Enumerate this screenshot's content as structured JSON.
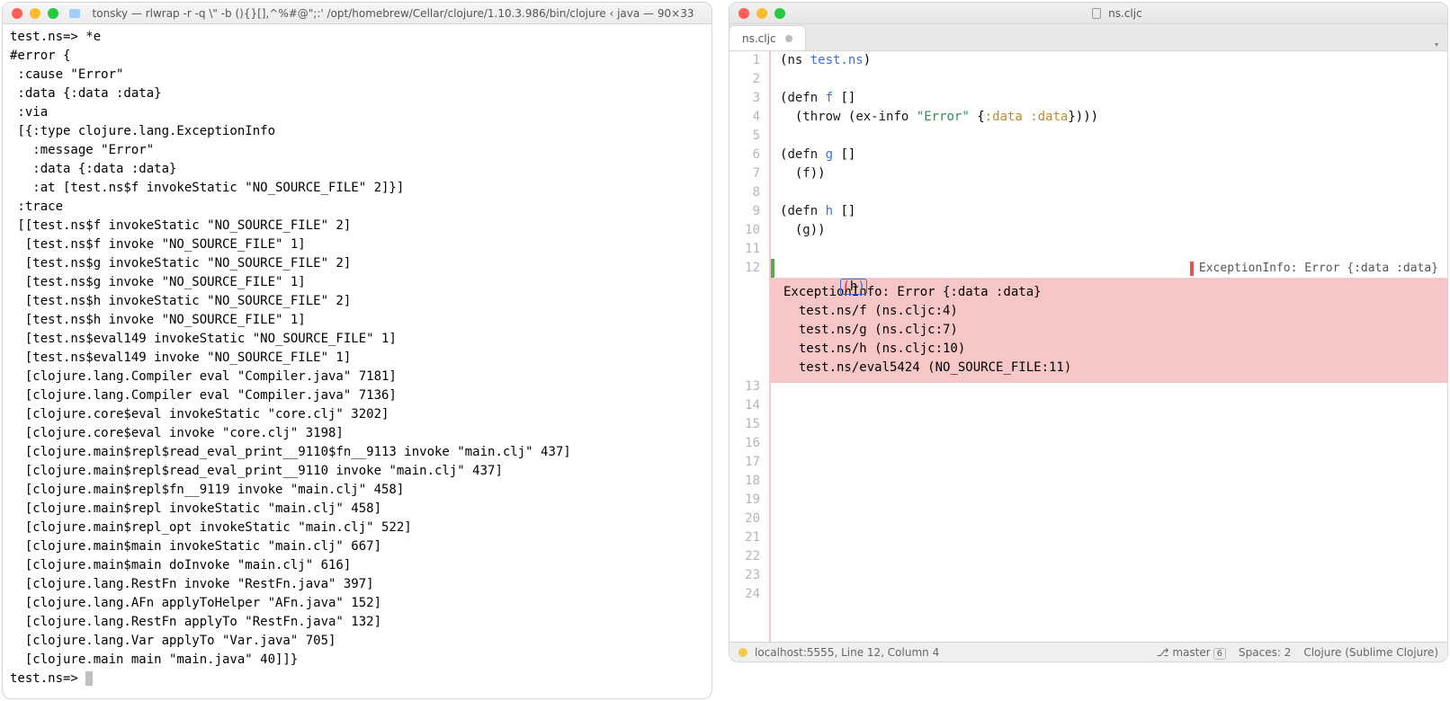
{
  "terminal": {
    "title": "tonsky — rlwrap -r -q \\\" -b (){}[],^%#@\";:' /opt/homebrew/Cellar/clojure/1.10.3.986/bin/clojure ‹ java — 90×33",
    "content": "test.ns=> *e\n#error {\n :cause \"Error\"\n :data {:data :data}\n :via\n [{:type clojure.lang.ExceptionInfo\n   :message \"Error\"\n   :data {:data :data}\n   :at [test.ns$f invokeStatic \"NO_SOURCE_FILE\" 2]}]\n :trace\n [[test.ns$f invokeStatic \"NO_SOURCE_FILE\" 2]\n  [test.ns$f invoke \"NO_SOURCE_FILE\" 1]\n  [test.ns$g invokeStatic \"NO_SOURCE_FILE\" 2]\n  [test.ns$g invoke \"NO_SOURCE_FILE\" 1]\n  [test.ns$h invokeStatic \"NO_SOURCE_FILE\" 2]\n  [test.ns$h invoke \"NO_SOURCE_FILE\" 1]\n  [test.ns$eval149 invokeStatic \"NO_SOURCE_FILE\" 1]\n  [test.ns$eval149 invoke \"NO_SOURCE_FILE\" 1]\n  [clojure.lang.Compiler eval \"Compiler.java\" 7181]\n  [clojure.lang.Compiler eval \"Compiler.java\" 7136]\n  [clojure.core$eval invokeStatic \"core.clj\" 3202]\n  [clojure.core$eval invoke \"core.clj\" 3198]\n  [clojure.main$repl$read_eval_print__9110$fn__9113 invoke \"main.clj\" 437]\n  [clojure.main$repl$read_eval_print__9110 invoke \"main.clj\" 437]\n  [clojure.main$repl$fn__9119 invoke \"main.clj\" 458]\n  [clojure.main$repl invokeStatic \"main.clj\" 458]\n  [clojure.main$repl_opt invokeStatic \"main.clj\" 522]\n  [clojure.main$main invokeStatic \"main.clj\" 667]\n  [clojure.main$main doInvoke \"main.clj\" 616]\n  [clojure.lang.RestFn invoke \"RestFn.java\" 397]\n  [clojure.lang.AFn applyToHelper \"AFn.java\" 152]\n  [clojure.lang.RestFn applyTo \"RestFn.java\" 132]\n  [clojure.lang.Var applyTo \"Var.java\" 705]\n  [clojure.main main \"main.java\" 40]]}",
    "prompt": "test.ns=> "
  },
  "editor": {
    "title": "ns.cljc",
    "tab": {
      "name": "ns.cljc"
    },
    "inline_error": "ExceptionInfo: Error {:data :data}",
    "error_block": "ExceptionInfo: Error {:data :data}\n  test.ns/f (ns.cljc:4)\n  test.ns/g (ns.cljc:7)\n  test.ns/h (ns.cljc:10)\n  test.ns/eval5424 (NO_SOURCE_FILE:11)",
    "line_numbers": [
      "1",
      "2",
      "3",
      "4",
      "5",
      "6",
      "7",
      "8",
      "9",
      "10",
      "11",
      "12"
    ],
    "post_line_numbers": [
      "13",
      "14",
      "15",
      "16",
      "17",
      "18",
      "19",
      "20",
      "21",
      "22",
      "23",
      "24"
    ],
    "code": {
      "l1a": "(",
      "l1b": "ns",
      "l1c": " ",
      "l1d": "test.ns",
      "l1e": ")",
      "l3a": "(",
      "l3b": "defn",
      "l3c": " ",
      "l3d": "f",
      "l3e": " []",
      "l4a": "  (",
      "l4b": "throw",
      "l4c": " (",
      "l4d": "ex-info",
      "l4e": " ",
      "l4f": "\"Error\"",
      "l4g": " {",
      "l4h": ":data :data",
      "l4i": "})))",
      "l6a": "(",
      "l6b": "defn",
      "l6c": " ",
      "l6d": "g",
      "l6e": " []",
      "l7a": "  (",
      "l7b": "f",
      "l7c": "))",
      "l9a": "(",
      "l9b": "defn",
      "l9c": " ",
      "l9d": "h",
      "l9e": " []",
      "l10a": "  (",
      "l10b": "g",
      "l10c": "))",
      "l12a": "(",
      "l12b": "h",
      "l12c": ")"
    },
    "status": {
      "conn": "localhost:5555, Line 12, Column 4",
      "branch": "master",
      "branch_count": "6",
      "spaces": "Spaces: 2",
      "syntax": "Clojure (Sublime Clojure)"
    }
  }
}
